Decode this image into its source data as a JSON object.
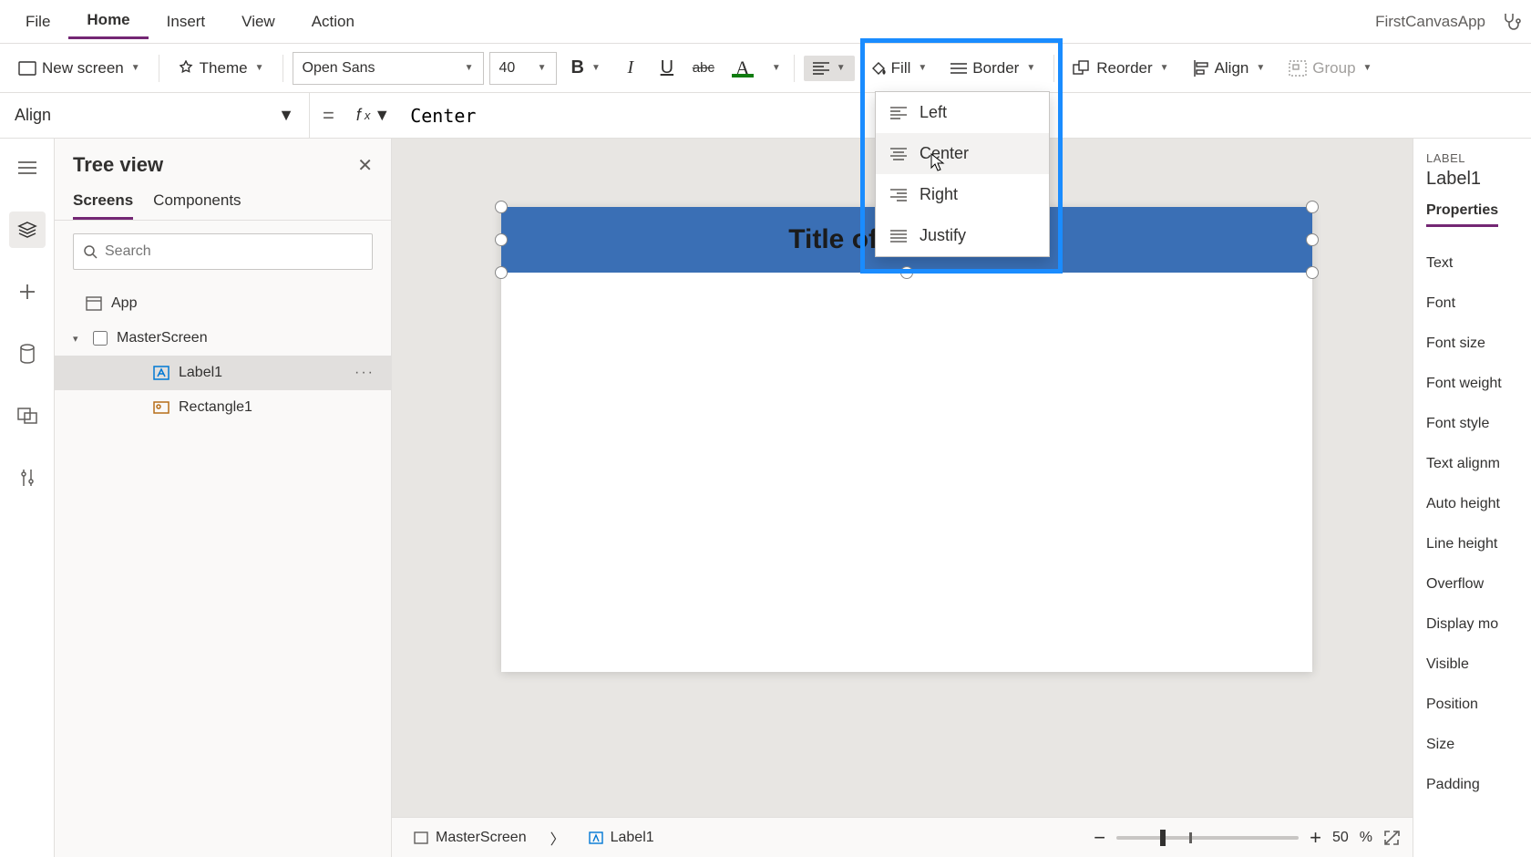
{
  "menubar": {
    "file": "File",
    "home": "Home",
    "insert": "Insert",
    "view": "View",
    "action": "Action",
    "app_name": "FirstCanvasApp"
  },
  "toolbar": {
    "new_screen": "New screen",
    "theme": "Theme",
    "font_name": "Open Sans",
    "font_size": "40",
    "fill": "Fill",
    "border": "Border",
    "reorder": "Reorder",
    "align": "Align",
    "group": "Group"
  },
  "formulabar": {
    "property": "Align",
    "value": "Center"
  },
  "tree": {
    "title": "Tree view",
    "tab_screens": "Screens",
    "tab_components": "Components",
    "search_placeholder": "Search",
    "app": "App",
    "master_screen": "MasterScreen",
    "label1": "Label1",
    "rectangle1": "Rectangle1"
  },
  "canvas": {
    "label_text": "Title of the Screen"
  },
  "align_dropdown": {
    "left": "Left",
    "center": "Center",
    "right": "Right",
    "justify": "Justify"
  },
  "props": {
    "type": "LABEL",
    "name": "Label1",
    "tab": "Properties",
    "rows": [
      "Text",
      "Font",
      "Font size",
      "Font weight",
      "Font style",
      "Text alignm",
      "Auto height",
      "Line height",
      "Overflow",
      "Display mo",
      "Visible",
      "Position",
      "Size",
      "Padding"
    ]
  },
  "status": {
    "crumb1": "MasterScreen",
    "crumb2": "Label1",
    "zoom_value": "50",
    "zoom_pct": "%"
  }
}
